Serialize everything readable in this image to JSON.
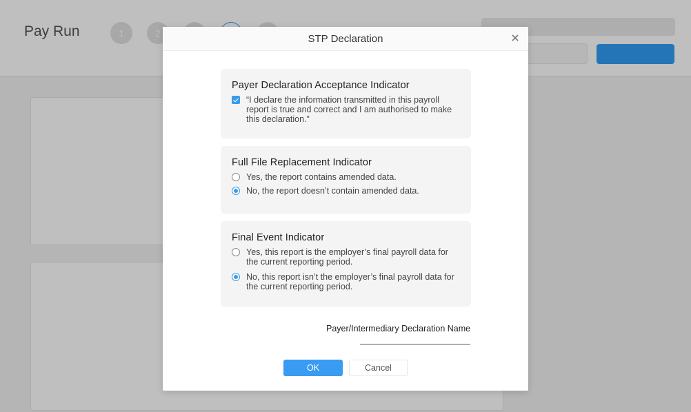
{
  "background": {
    "page_title": "Pay Run",
    "steps": [
      "1",
      "2",
      "3",
      "4",
      "5"
    ],
    "accent_color": "#2f9cf4"
  },
  "modal": {
    "title": "STP Declaration",
    "close_icon": "close-icon",
    "payer_declaration": {
      "title": "Payer Declaration Acceptance Indicator",
      "text": "“I declare the information transmitted in this payroll report is true and correct and I am authorised to make this declaration.”",
      "checked": true
    },
    "full_file_replacement": {
      "title": "Full File Replacement Indicator",
      "options": [
        {
          "label": "Yes, the report contains amended data.",
          "selected": false
        },
        {
          "label": "No, the report doesn’t contain amended data.",
          "selected": true
        }
      ]
    },
    "final_event": {
      "title": "Final Event Indicator",
      "options": [
        {
          "label": "Yes, this report is the employer’s final payroll data for the current reporting period.",
          "selected": false
        },
        {
          "label": "No, this report isn’t the employer’s final payroll data for the current reporting period.",
          "selected": true
        }
      ]
    },
    "declaration_name": {
      "label": "Payer/Intermediary Declaration Name",
      "value": ""
    },
    "ok_label": "OK",
    "cancel_label": "Cancel"
  }
}
